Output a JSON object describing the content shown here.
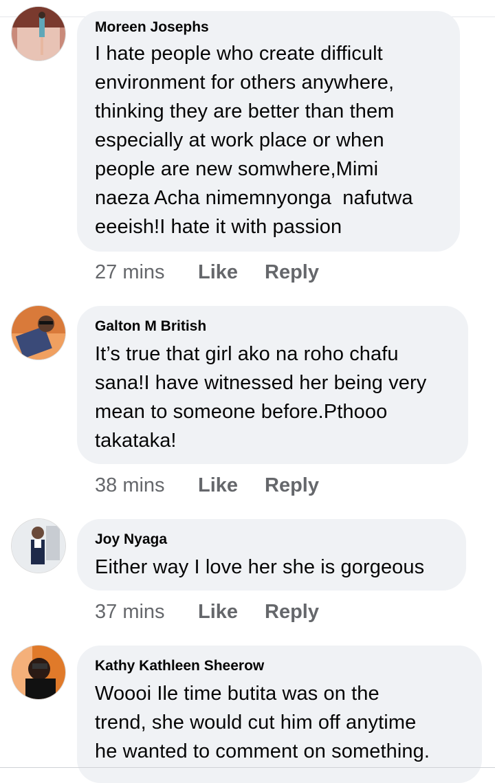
{
  "comments": [
    {
      "name": "Moreen Josephs",
      "lines": [
        "I hate people who create difficult",
        "environment for others anywhere,",
        "thinking they are better than them",
        "especially at work place or when",
        "people are new somwhere,Mimi",
        "naeza Acha nimemnyonga  nafutwa",
        "eeeish!I hate it with passion"
      ],
      "time": "27 mins",
      "like": "Like",
      "reply": "Reply"
    },
    {
      "name": "Galton M British",
      "lines": [
        "It’s true that girl ako na roho chafu",
        "sana!I have witnessed her being very",
        "mean to someone before.Pthooo",
        "takataka!"
      ],
      "time": "38 mins",
      "like": "Like",
      "reply": "Reply"
    },
    {
      "name": "Joy Nyaga",
      "lines": [
        "Either way I love her she is gorgeous"
      ],
      "time": "37 mins",
      "like": "Like",
      "reply": "Reply"
    },
    {
      "name": "Kathy Kathleen Sheerow",
      "lines": [
        "Woooi Ile time butita was on the",
        "trend, she would cut him off anytime",
        "he wanted to comment on something."
      ]
    }
  ]
}
